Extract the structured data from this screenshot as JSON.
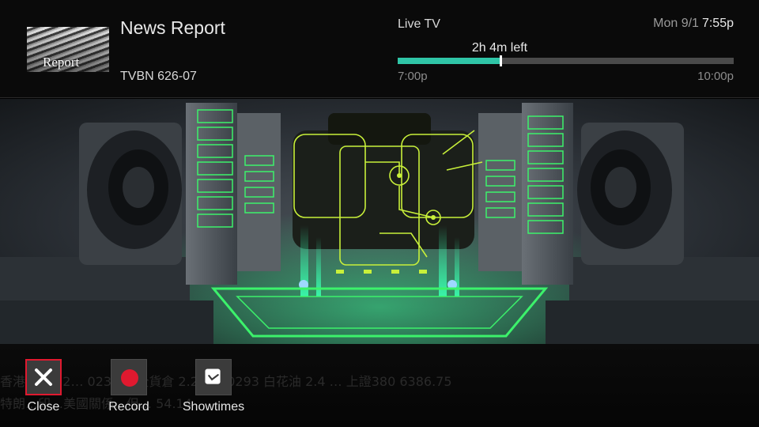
{
  "header": {
    "thumbnail_text": "Report",
    "program_title": "News Report",
    "channel": "TVBN 626-07",
    "source": "Live TV",
    "date": "Mon 9/1",
    "time": "7:55p",
    "time_left": "2h 4m left",
    "start_time": "7:00p",
    "end_time": "10:00p",
    "progress_fraction": 0.305
  },
  "ticker": {
    "line1": "香港…牌 12… 0237 安全貨倉 2.23 … 0293 白花油 2.4 … 上證380 6386.75",
    "line2": "特朗…印…美國關係…但… 54.14"
  },
  "actions": [
    {
      "label": "Close",
      "icon": "close-icon"
    },
    {
      "label": "Record",
      "icon": "record-icon"
    },
    {
      "label": "Showtimes",
      "icon": "clock-icon"
    }
  ],
  "colors": {
    "accent_progress": "#2fc5a7",
    "focus_border": "#e0192f",
    "record_red": "#e0192f"
  }
}
